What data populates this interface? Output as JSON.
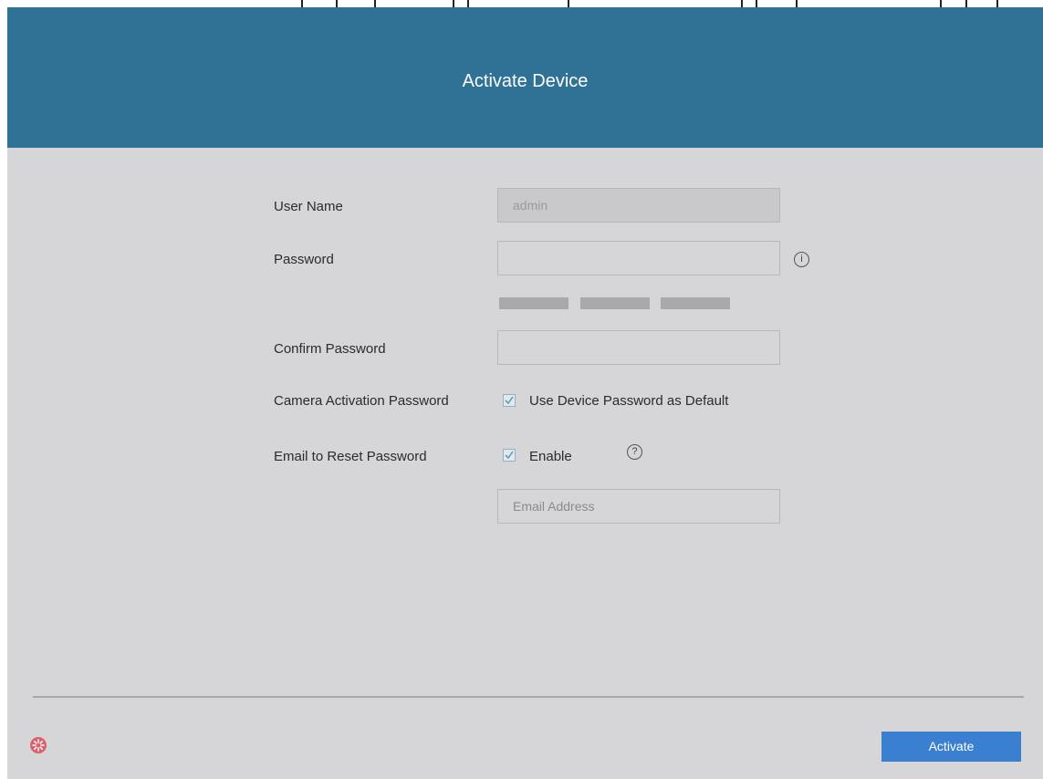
{
  "header": {
    "title": "Activate Device"
  },
  "form": {
    "username_label": "User Name",
    "username_value": "admin",
    "password_label": "Password",
    "password_value": "",
    "confirm_label": "Confirm Password",
    "confirm_value": "",
    "camera_label": "Camera Activation Password",
    "camera_checkbox_label": "Use Device Password as Default",
    "camera_checked": true,
    "email_label": "Email to Reset Password",
    "email_checkbox_label": "Enable",
    "email_checked": true,
    "email_placeholder": "Email Address"
  },
  "icons": {
    "password_info": "info-icon",
    "email_help": "help-icon",
    "status": "gear-icon"
  },
  "footer": {
    "activate_label": "Activate"
  },
  "colors": {
    "header_bg": "#2f7296",
    "body_bg": "#d6d6d9",
    "button_bg": "#3b7fd1",
    "status_icon": "#d9626f"
  }
}
